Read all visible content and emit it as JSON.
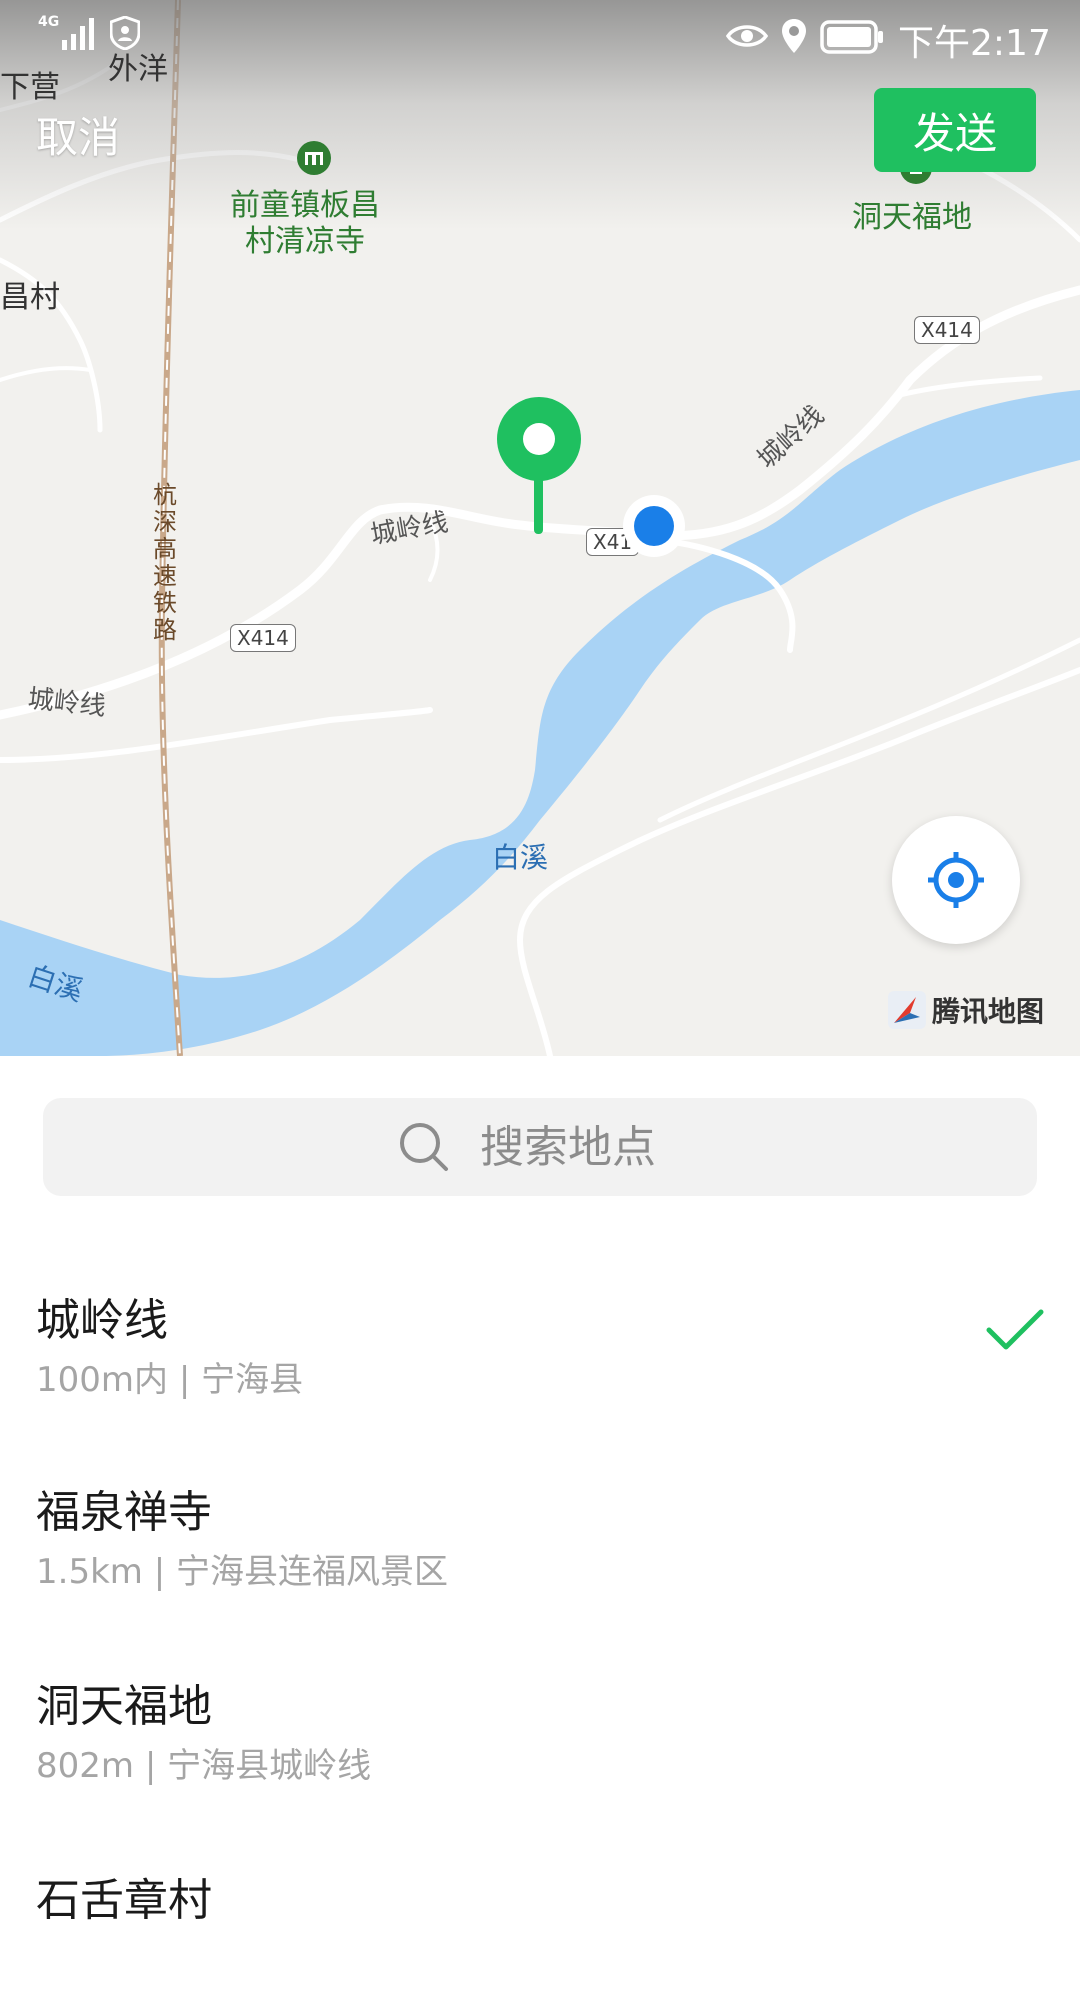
{
  "status_bar": {
    "network": "4G",
    "time": "下午2:17"
  },
  "header": {
    "cancel_label": "取消",
    "send_label": "发送"
  },
  "map": {
    "place_labels": {
      "xiaying": "下营",
      "waiyang": "外洋",
      "changcun": "昌村"
    },
    "poi_labels": {
      "temple": "前童镇板昌\n村清凉寺",
      "dongtian": "洞天福地"
    },
    "road_labels": {
      "chengling_1": "城岭线",
      "chengling_2": "城岭线",
      "chengling_3": "城岭线"
    },
    "route_badges": {
      "b1": "X414",
      "b2": "X414",
      "b3": "X41"
    },
    "railway_label": "杭深高速铁路",
    "river_labels": {
      "r1": "白溪",
      "r2": "白溪"
    },
    "attribution": "腾讯地图",
    "colors": {
      "land": "#f2f1ee",
      "water": "#a9d3f5",
      "pin": "#1fc060",
      "current_location": "#1a7fe8"
    }
  },
  "search": {
    "placeholder": "搜索地点"
  },
  "places": [
    {
      "name": "城岭线",
      "detail": "100m内 | 宁海县",
      "selected": true
    },
    {
      "name": "福泉禅寺",
      "detail": "1.5km | 宁海县连福风景区",
      "selected": false
    },
    {
      "name": "洞天福地",
      "detail": "802m | 宁海县城岭线",
      "selected": false
    },
    {
      "name": "石舌章村",
      "detail": "",
      "selected": false
    }
  ]
}
